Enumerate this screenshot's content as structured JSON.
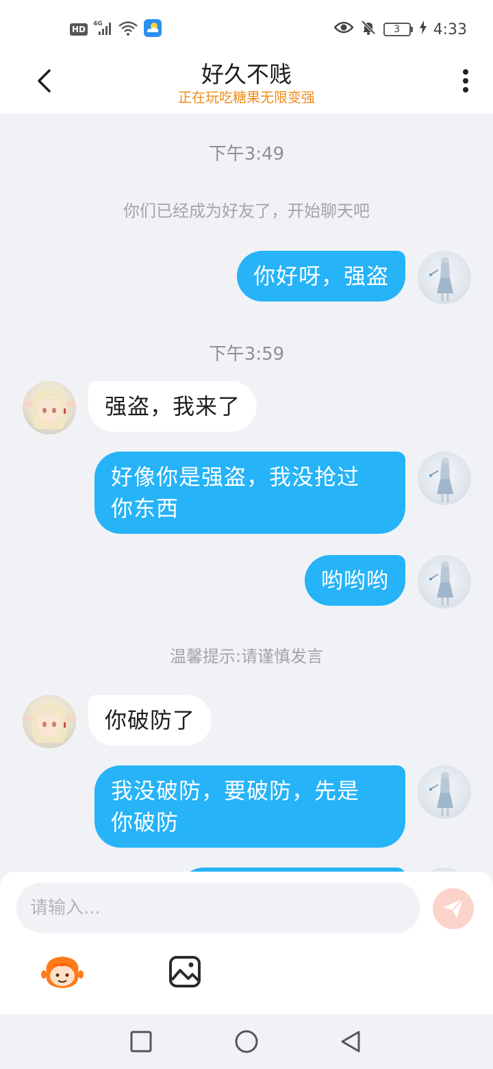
{
  "status_bar": {
    "hd": "HD",
    "network": "4G",
    "battery_level": "3",
    "time": "4:33"
  },
  "header": {
    "title": "好久不贱",
    "subtitle": "正在玩吃糖果无限变强"
  },
  "chat": {
    "time_1": "下午3:49",
    "system_friend": "你们已经成为好友了，开始聊天吧",
    "msg_1": "你好呀，强盗",
    "time_2": "下午3:59",
    "msg_2": "强盗，我来了",
    "msg_3_line1": "好像你是强盗，我没抢过",
    "msg_3_line2": "你东西",
    "msg_4": "哟哟哟",
    "system_tip": "温馨提示:请谨慎发言",
    "msg_5": "你破防了",
    "msg_6_line1": "我没破防，要破防，先是",
    "msg_6_line2": "你破防"
  },
  "input": {
    "placeholder": "请输入..."
  },
  "colors": {
    "self_bubble": "#26b3f7",
    "subtitle": "#f08c1a",
    "send_button": "#fbd3cb"
  },
  "icons": [
    "back-arrow-icon",
    "more-vertical-icon",
    "send-icon",
    "emoji-icon",
    "image-icon",
    "recent-apps-icon",
    "home-icon",
    "back-triangle-icon"
  ]
}
